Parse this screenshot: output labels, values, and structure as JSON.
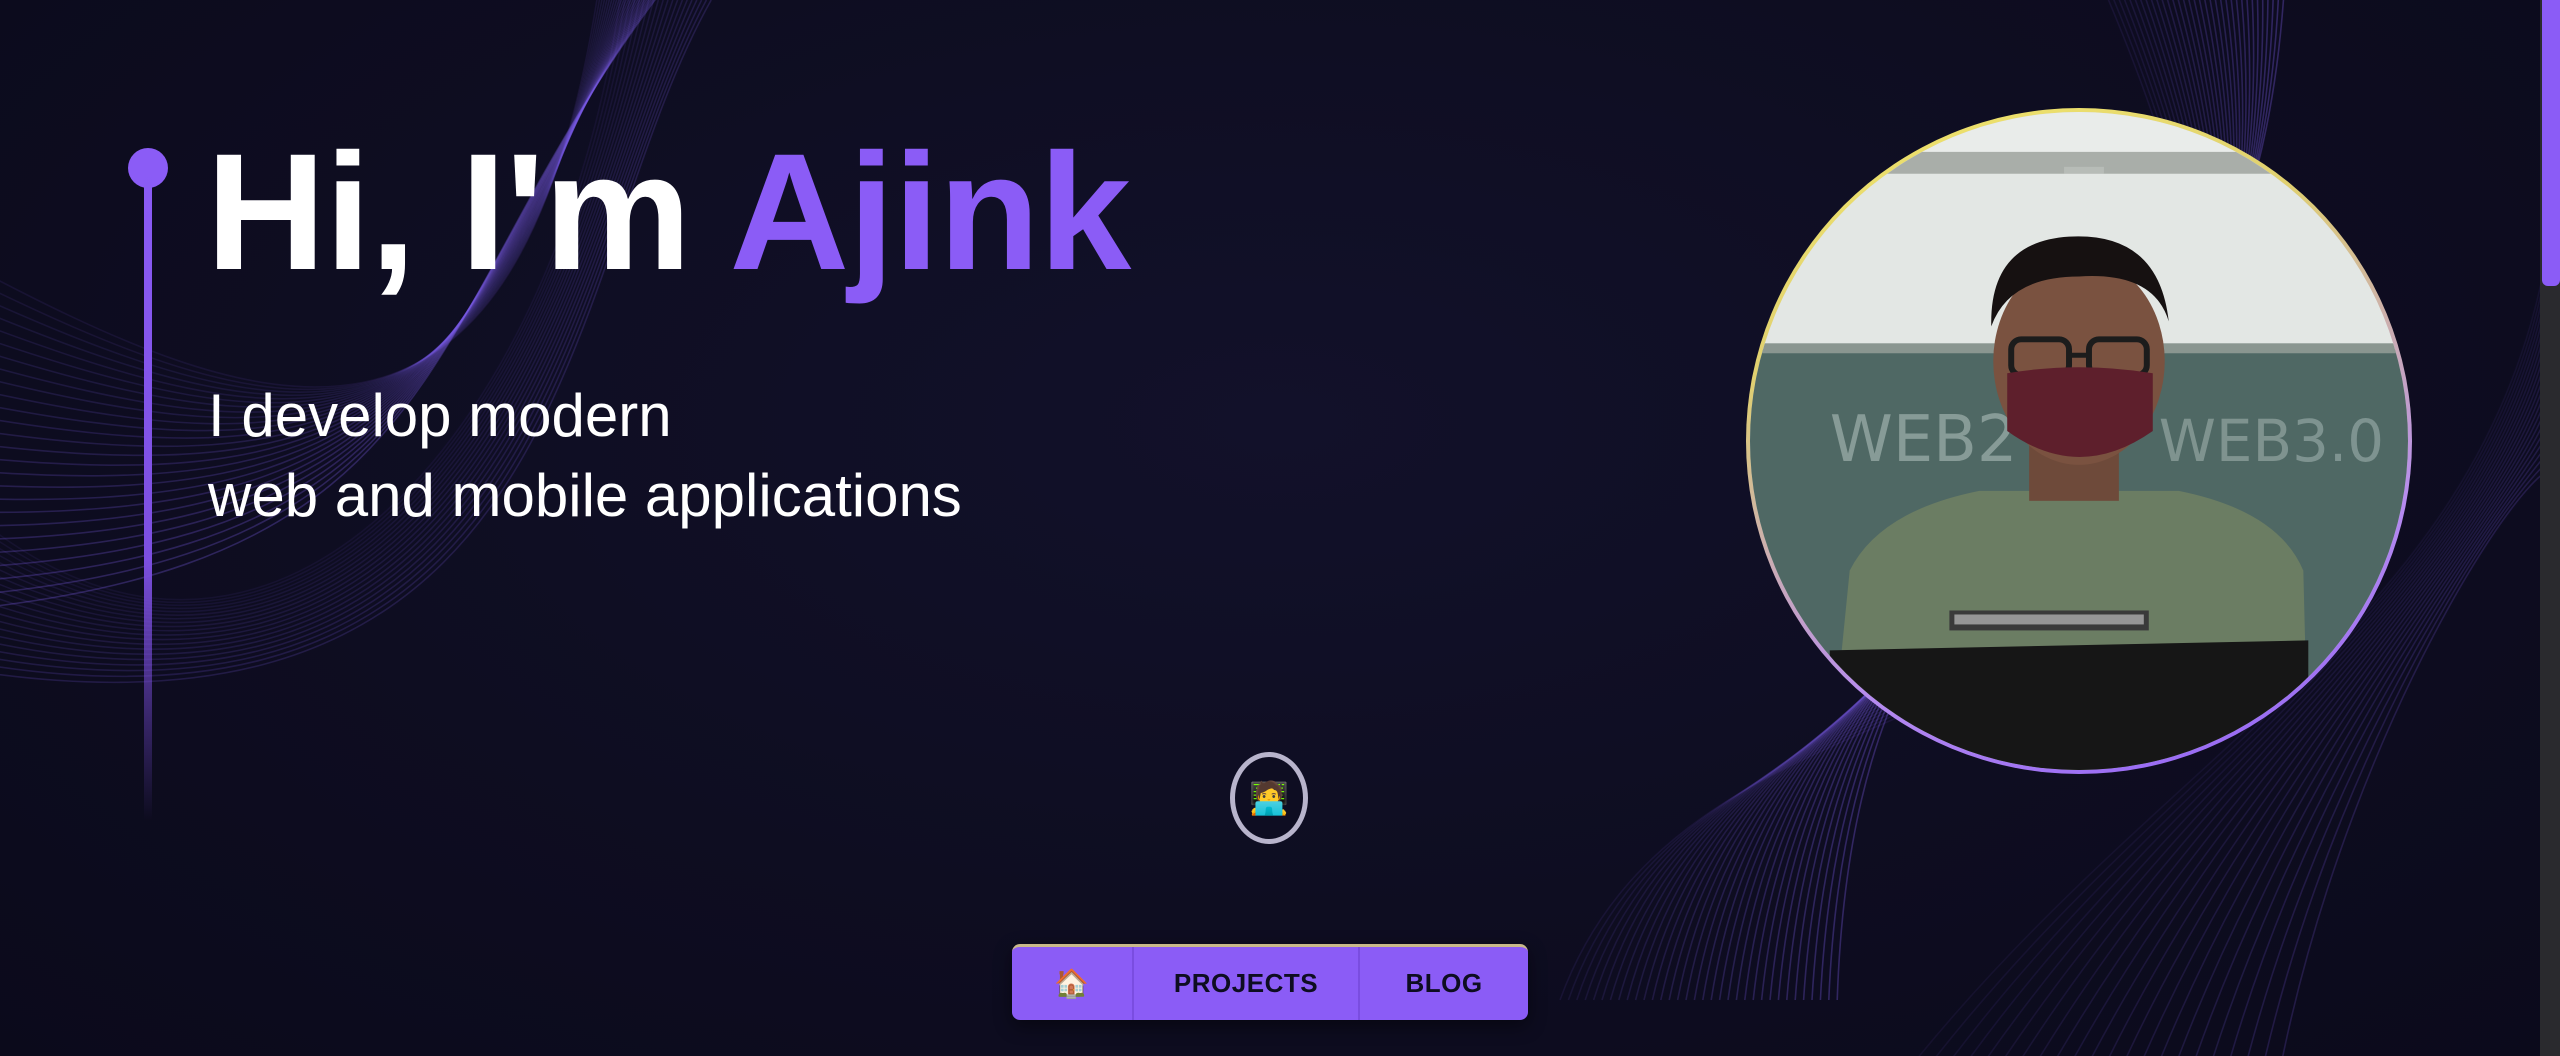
{
  "hero": {
    "greeting": "Hi, I'm ",
    "name": "Ajink",
    "tagline_line1": "I develop modern",
    "tagline_line2": "web and mobile applications"
  },
  "portrait": {
    "alt": "Profile photo"
  },
  "avatar_button": {
    "emoji": "🧑‍💻"
  },
  "nav": {
    "home_icon": "🏠",
    "projects_label": "PROJECTS",
    "blog_label": "BLOG"
  },
  "colors": {
    "background": "#0e0d21",
    "accent": "#8b5cf6",
    "text": "#ffffff",
    "portrait_ring_top": "#f3e86a"
  }
}
